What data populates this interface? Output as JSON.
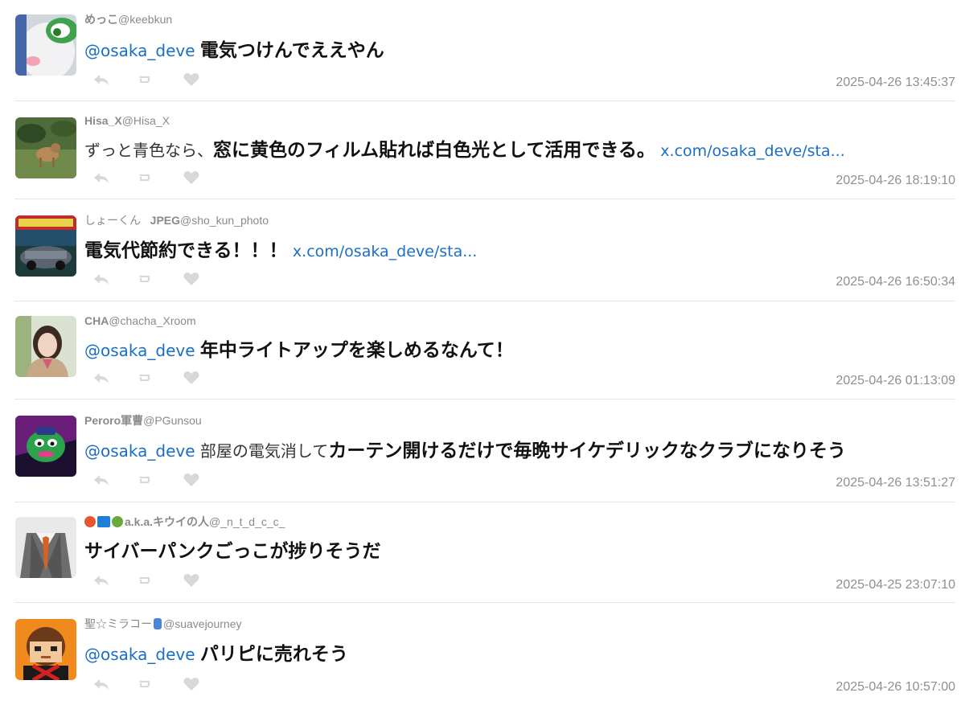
{
  "colors": {
    "mention": "#1a6fc4",
    "meta": "#8a8a8a",
    "action_icon": "#d8d8d8",
    "divider": "#e6e6e6"
  },
  "icons": {
    "reply": "reply-icon",
    "retweet": "retweet-icon",
    "like": "heart-icon"
  },
  "tweets": [
    {
      "display_name": "めっこ",
      "handle": "@keebkun",
      "mention": "@osaka_deve",
      "plain": "",
      "strong": "電気つけんでええやん",
      "link": "",
      "timestamp": "2025-04-26 13:45:37"
    },
    {
      "display_name": "Hisa_X",
      "handle": "@Hisa_X",
      "mention": "",
      "plain": "ずっと青色なら、",
      "strong": "窓に黄色のフィルム貼れば白色光として活用できる。",
      "link": "x.com/osaka_deve/sta...",
      "timestamp": "2025-04-26 18:19:10"
    },
    {
      "display_name": "しょーくん",
      "display_name_suffix": "JPEG",
      "handle": "@sho_kun_photo",
      "mention": "",
      "plain": "",
      "strong": "電気代節約できる！！！",
      "link": "x.com/osaka_deve/sta...",
      "timestamp": "2025-04-26 16:50:34"
    },
    {
      "display_name": "CHA",
      "handle": "@chacha_Xroom",
      "mention": "@osaka_deve",
      "plain": "",
      "strong": "年中ライトアップを楽しめるなんて！",
      "link": "",
      "timestamp": "2025-04-26 01:13:09"
    },
    {
      "display_name": "Peroro軍曹",
      "handle": "@PGunsou",
      "mention": "@osaka_deve",
      "plain": "部屋の電気消して",
      "strong": "カーテン開けるだけで毎晩サイケデリックなクラブになりそう",
      "link": "",
      "timestamp": "2025-04-26 13:51:27"
    },
    {
      "display_name": "a.k.a.キウイの人",
      "handle": "@_n_t_d_c_c_",
      "mention": "",
      "plain": "",
      "strong": "サイバーパンクごっこが捗りそうだ",
      "link": "",
      "timestamp": "2025-04-25 23:07:10"
    },
    {
      "display_name": "聖☆ミラコー",
      "handle": "@suavejourney",
      "mention": "@osaka_deve",
      "plain": "",
      "strong": "パリピに売れそう",
      "link": "",
      "timestamp": "2025-04-26 10:57:00"
    }
  ]
}
